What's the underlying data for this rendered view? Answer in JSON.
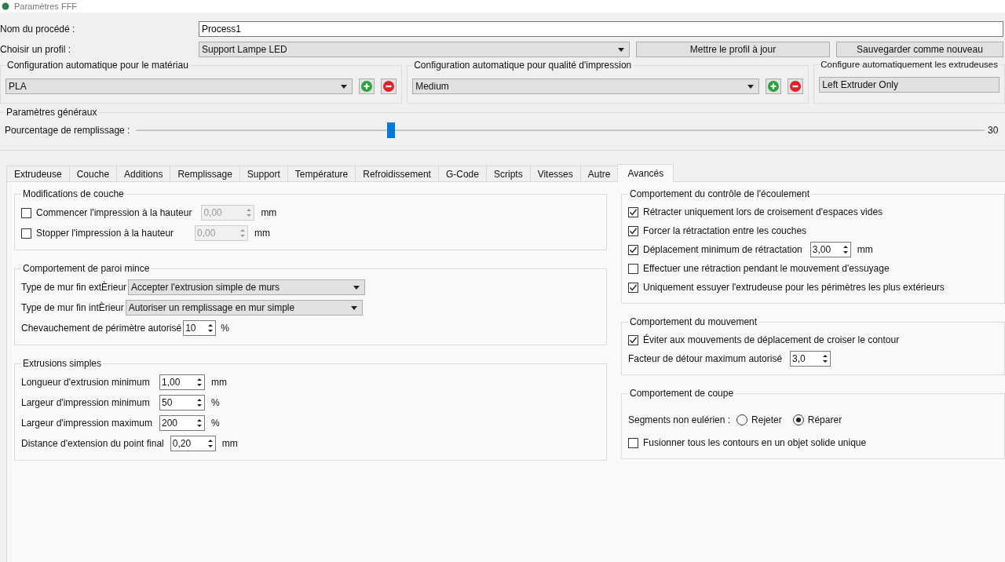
{
  "window": {
    "title": "Paramètres FFF"
  },
  "process_name": {
    "label": "Nom du procédé :",
    "value": "Process1"
  },
  "profile": {
    "label": "Choisir un profil :",
    "value": "Support Lampe LED",
    "buttons": [
      "Mettre le profil à jour",
      "Sauvegarder comme nouveau"
    ]
  },
  "auto_config": [
    {
      "title": "Configuration automatique pour le matériau",
      "value": "PLA",
      "kind": "editable"
    },
    {
      "title": "Configuration automatique pour qualité d'impression",
      "value": "Medium",
      "kind": "editable"
    },
    {
      "title": "Configure automatiquement les extrudeuses",
      "value": "Left Extruder Only",
      "kind": "plain"
    }
  ],
  "general": {
    "title": "Paramètres généraux",
    "infill": {
      "label": "Pourcentage de remplissage :",
      "level": 0.3,
      "reading": "30"
    }
  },
  "tabs": [
    {
      "label": "Extrudeuse",
      "selected": false
    },
    {
      "label": "Couche",
      "selected": false
    },
    {
      "label": "Additions",
      "selected": false
    },
    {
      "label": "Remplissage",
      "selected": false
    },
    {
      "label": "Support",
      "selected": false
    },
    {
      "label": "Température",
      "selected": false
    },
    {
      "label": "Refroidissement",
      "selected": false
    },
    {
      "label": "G-Code",
      "selected": false
    },
    {
      "label": "Scripts",
      "selected": false
    },
    {
      "label": "Vitesses",
      "selected": false
    },
    {
      "label": "Autre",
      "selected": false
    },
    {
      "label": "Avancés",
      "selected": true
    }
  ],
  "left_groups": [
    {
      "title": "Modifications de couche",
      "rows": [
        {
          "kind": "check_spin",
          "label": "Commencer l'impression à la hauteur",
          "checked": false,
          "value": "0,00",
          "unit": "mm",
          "disabled": true
        },
        {
          "kind": "check_spin",
          "label": "Stopper  l'impression à la hauteur",
          "checked": false,
          "value": "0,00",
          "unit": "mm",
          "disabled": true
        }
      ]
    },
    {
      "title": "Comportement de paroi mince",
      "rows": [
        {
          "kind": "combo",
          "label": "Type de mur fin extÈrieur",
          "value": "Accepter l'extrusion simple de murs"
        },
        {
          "kind": "combo",
          "label": "Type de mur fin intÈrieur",
          "value": "Autoriser un remplissage en mur simple"
        },
        {
          "kind": "spin",
          "label": "Chevauchement de périmètre autorisé",
          "value": "10",
          "unit": "%",
          "disabled": false
        }
      ]
    },
    {
      "title": "Extrusions simples",
      "rows": [
        {
          "kind": "spin",
          "label": "Longueur d'extrusion minimum",
          "value": "1,00",
          "unit": "mm",
          "disabled": false
        },
        {
          "kind": "spin",
          "label": "Largeur d'impression minimum",
          "value": "50",
          "unit": "%",
          "disabled": false
        },
        {
          "kind": "spin",
          "label": "Largeur d'impression maximum",
          "value": "200",
          "unit": "%",
          "disabled": false
        },
        {
          "kind": "spin",
          "label": "Distance d'extension du point final",
          "value": "0,20",
          "unit": "mm",
          "disabled": false
        }
      ]
    }
  ],
  "right_groups": [
    {
      "title": "Comportement du contrôle de l'écoulement",
      "rows": [
        {
          "kind": "check",
          "label": "Rétracter uniquement lors de croisement d'espaces vides",
          "checked": true
        },
        {
          "kind": "check",
          "label": "Forcer la rétractation entre les couches",
          "checked": true
        },
        {
          "kind": "check_spin",
          "label": "Déplacement minimum de rétractation",
          "checked": true,
          "value": "3,00",
          "unit": "mm",
          "disabled": false
        },
        {
          "kind": "check",
          "label": "Effectuer une rétraction pendant le mouvement d'essuyage",
          "checked": false
        },
        {
          "kind": "check",
          "label": "Uniquement essuyer l'extrudeuse pour les périmètres les plus extérieurs",
          "checked": true
        }
      ]
    },
    {
      "title": "Comportement du mouvement",
      "rows": [
        {
          "kind": "check",
          "label": "Éviter aux mouvements de déplacement de croiser le contour",
          "checked": true
        },
        {
          "kind": "spin",
          "label": "Facteur de détour maximum autorisé",
          "value": "3,0",
          "disabled": false
        }
      ]
    },
    {
      "title": "Comportement de coupe",
      "rows": [
        {
          "kind": "radio",
          "label": "Segments non eulérien :",
          "options": [
            {
              "label": "Rejeter",
              "selected": false
            },
            {
              "label": "Réparer",
              "selected": true
            }
          ]
        },
        {
          "kind": "check",
          "label": "Fusionner tous les contours en un objet solide unique",
          "checked": false
        }
      ]
    }
  ]
}
